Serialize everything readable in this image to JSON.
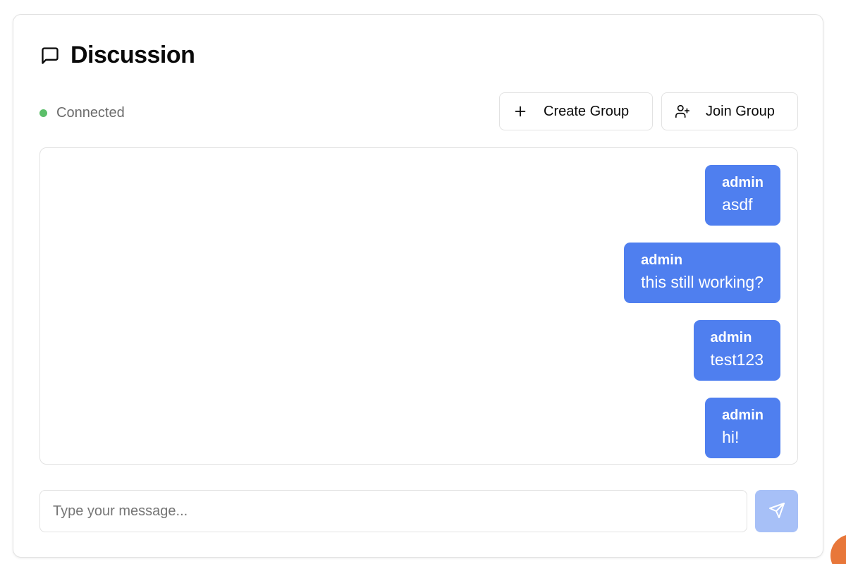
{
  "header": {
    "title": "Discussion",
    "title_icon": "message-square-icon"
  },
  "status": {
    "label": "Connected",
    "color": "#5cbf6a"
  },
  "actions": {
    "create_group": {
      "label": "Create Group",
      "icon": "plus-icon"
    },
    "join_group": {
      "label": "Join Group",
      "icon": "user-plus-icon"
    }
  },
  "messages": [
    {
      "user": "admin",
      "text": "asdf"
    },
    {
      "user": "admin",
      "text": "this still working?"
    },
    {
      "user": "admin",
      "text": "test123"
    },
    {
      "user": "admin",
      "text": "hi!"
    }
  ],
  "composer": {
    "placeholder": "Type your message...",
    "value": "",
    "send_icon": "send-icon"
  },
  "colors": {
    "bubble": "#4f7fef",
    "send_button_disabled": "#a7c0f7",
    "floating_widget": "#e8773a"
  }
}
